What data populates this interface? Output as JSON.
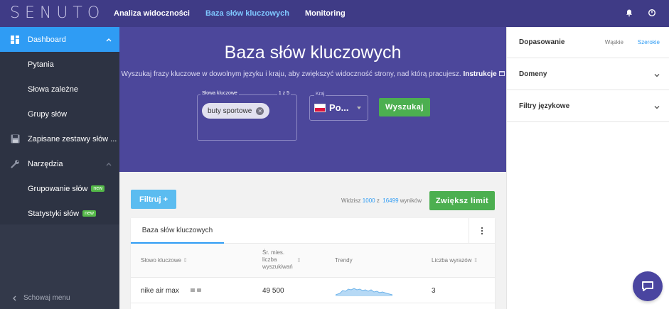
{
  "app": {
    "logo": "SENUTO"
  },
  "topnav": {
    "items": [
      "Analiza widoczności",
      "Baza słów kluczowych",
      "Monitoring"
    ],
    "active_index": 1
  },
  "sidebar": {
    "items": [
      {
        "label": "Dashboard",
        "level": "main"
      },
      {
        "label": "Pytania",
        "level": "sub"
      },
      {
        "label": "Słowa zależne",
        "level": "sub"
      },
      {
        "label": "Grupy słów",
        "level": "sub"
      },
      {
        "label": "Zapisane zestawy słów ...",
        "level": "main"
      },
      {
        "label": "Narzędzia",
        "level": "main"
      },
      {
        "label": "Grupowanie słów",
        "level": "sub",
        "badge": "new"
      },
      {
        "label": "Statystyki słów",
        "level": "sub",
        "badge": "new"
      }
    ],
    "collapse_label": "Schowaj menu"
  },
  "hero": {
    "title": "Baza słów kluczowych",
    "subtitle": "Wyszukaj frazy kluczowe w dowolnym języku i kraju, aby zwiększyć widoczność strony, nad którą pracujesz.",
    "instructions_link": "Instrukcje",
    "keywords_label": "Słowa kluczowe",
    "keywords_count": "1 z 5",
    "keyword_chip": "buty sportowe",
    "country_label": "Kraj",
    "country_value": "Po...",
    "search_button": "Wyszukaj"
  },
  "toolbar": {
    "filter_button": "Filtruj +",
    "results_prefix": "Widzisz",
    "results_shown": "1000",
    "results_mid": "z",
    "results_total": "16499",
    "results_suffix": "wyników",
    "limit_button": "Zwiększ limit"
  },
  "table": {
    "tab_label": "Baza słów kluczowych",
    "columns": [
      "Słowo kluczowe",
      "Śr. mies. liczba wyszukiwań",
      "Trendy",
      "Liczba wyrazów"
    ],
    "rows": [
      {
        "keyword": "nike air max",
        "searches": "49 500",
        "words": "3"
      }
    ]
  },
  "right_panel": {
    "match_label": "Dopasowanie",
    "match_options": [
      "Wąskie",
      "Szerokie"
    ],
    "match_active": 1,
    "domains_label": "Domeny",
    "language_filters_label": "Filtry językowe"
  },
  "colors": {
    "topbar": "#3f3b86",
    "hero": "#4c479b",
    "accent": "#2f9cf4",
    "green": "#4caf50",
    "sidebar": "#2d3343"
  }
}
